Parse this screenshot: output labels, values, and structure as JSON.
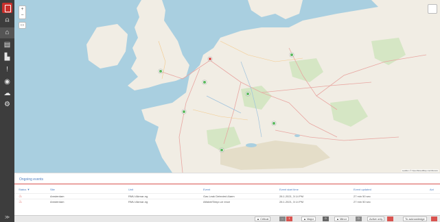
{
  "sidebar": {
    "items": [
      {
        "icon": "user-icon",
        "glyph": "⍝"
      },
      {
        "icon": "home-icon",
        "glyph": "⌂"
      },
      {
        "icon": "document-icon",
        "glyph": "▤"
      },
      {
        "icon": "chart-icon",
        "glyph": "▙"
      },
      {
        "icon": "alert-icon",
        "glyph": "!"
      },
      {
        "icon": "location-icon",
        "glyph": "◉"
      },
      {
        "icon": "cloud-icon",
        "glyph": "☁"
      },
      {
        "icon": "gear-icon",
        "glyph": "⚙"
      }
    ],
    "bottom_label": "≫"
  },
  "map": {
    "zoom_in": "+",
    "zoom_out": "−",
    "layer_icon": "layers-icon",
    "attribution": "Leaflet | © OpenStreetMap contributors",
    "marker_colors": {
      "green": "#5cb85c",
      "red": "#d9534f"
    }
  },
  "events": {
    "title": "Ongoing events",
    "headers": {
      "status": "Status ▼",
      "site": "Site",
      "unit": "Unit",
      "event": "Event",
      "start": "Event start time",
      "updated": "Event updated",
      "act": "Act"
    },
    "rows": [
      {
        "site": "Amsterdam",
        "unit": "RMU Alkmar-ng",
        "event": "Gas Leak Detected Alarm",
        "start": "28.1.2021, 3:14 PM",
        "updated": "27 min 50 sec"
      },
      {
        "site": "Amsterdam",
        "unit": "RMU Alkmar-ng",
        "event": "Alfaknt/Simpr-ce ence",
        "start": "28.1.2021, 3:14 PM",
        "updated": "27 min 50 sec"
      }
    ]
  },
  "footer": {
    "critical_label": "Critical",
    "critical_count": "1",
    "major_label": "Major",
    "major_count": "0",
    "minor_label": "Minor",
    "minor_count": "0",
    "active_only_label": "Active only",
    "unacknowledge_label": "To acknowledge"
  }
}
